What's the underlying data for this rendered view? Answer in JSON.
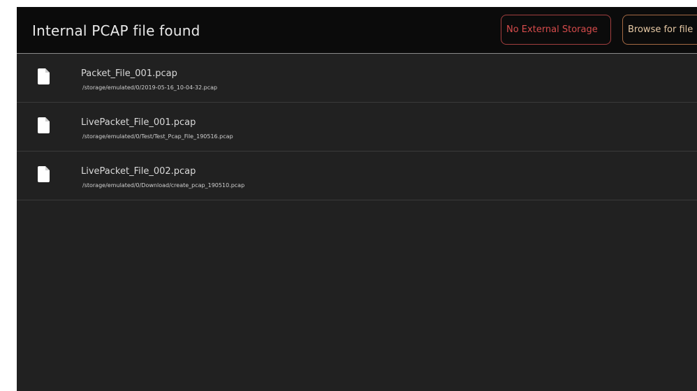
{
  "header": {
    "title": "Internal PCAP file found",
    "no_external_storage_label": "No External Storage",
    "browse_label": "Browse for file"
  },
  "files": [
    {
      "name": "Packet_File_001.pcap",
      "path": "/storage/emulated/0/2019-05-16_10-04-32.pcap",
      "icon": "file-icon"
    },
    {
      "name": "LivePacket_File_001.pcap",
      "path": "/storage/emulated/0/Test/Test_Pcap_File_190516.pcap",
      "icon": "file-icon"
    },
    {
      "name": "LivePacket_File_002.pcap",
      "path": "/storage/emulated/0/Download/create_pcap_190510.pcap",
      "icon": "file-icon"
    }
  ],
  "colors": {
    "background": "#212121",
    "header_background": "#0b0b0b",
    "accent_red": "#d64b4b",
    "accent_orange": "#a56a44"
  }
}
